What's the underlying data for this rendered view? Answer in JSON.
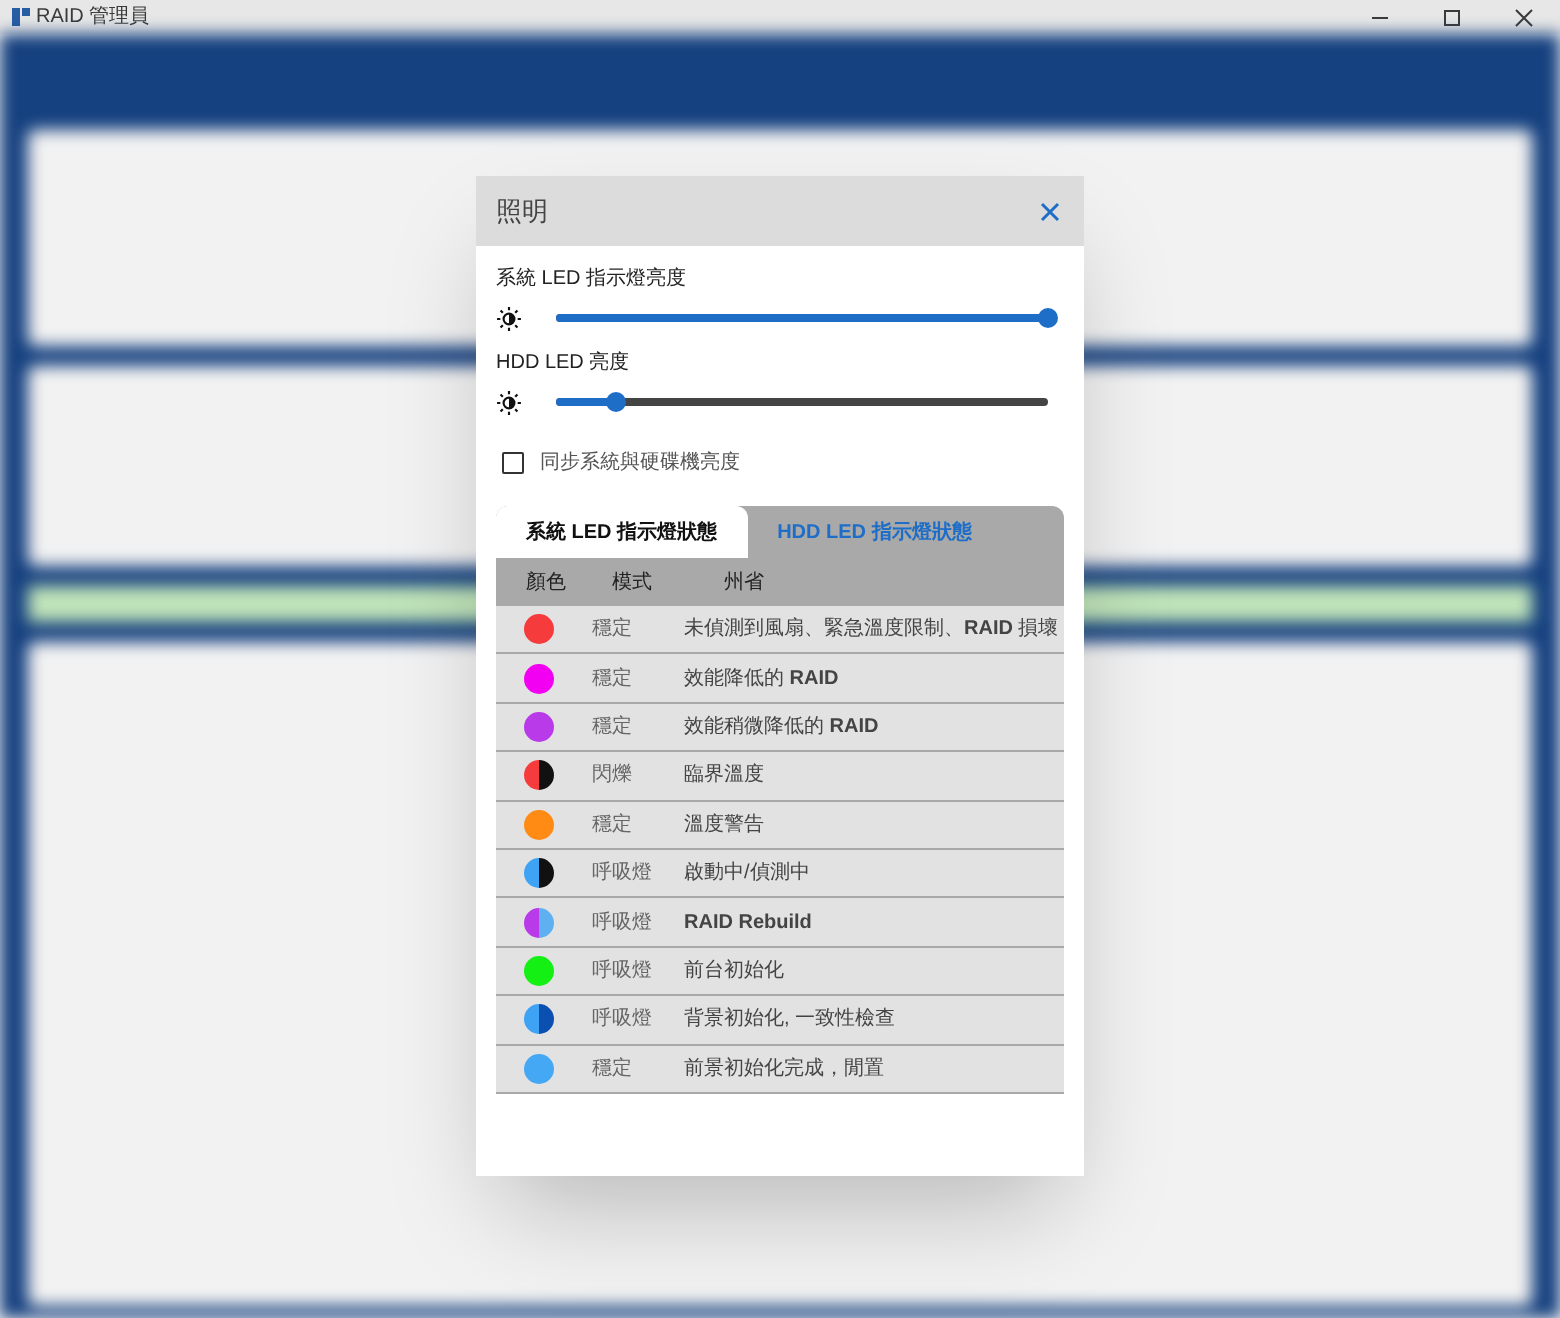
{
  "window": {
    "title": "RAID 管理員"
  },
  "dialog": {
    "title": "照明",
    "sliders": [
      {
        "label": "系統 LED 指示燈亮度",
        "level": 1.0
      },
      {
        "label": "HDD LED 亮度",
        "level": 0.12
      }
    ],
    "sync": {
      "label": "同步系統與硬碟機亮度",
      "checked": false
    },
    "tabs": [
      {
        "label": "系統 LED 指示燈狀態",
        "selected": true
      },
      {
        "label": "HDD LED 指示燈狀態",
        "selected": false
      }
    ],
    "table": {
      "columns": [
        "顏色",
        "模式",
        "州省"
      ],
      "rows": [
        {
          "kind": "solid",
          "color": "#f53b3b",
          "mode": "穩定",
          "description": "未偵測到風扇、緊急溫度限制、**RAID** 損壞"
        },
        {
          "kind": "solid",
          "color": "#f200f2",
          "mode": "穩定",
          "description": "效能降低的 **RAID**"
        },
        {
          "kind": "solid",
          "color": "#b83ae8",
          "mode": "穩定",
          "description": "效能稍微降低的 **RAID**"
        },
        {
          "kind": "split",
          "halves": [
            {
              "color": "#f53b3b"
            },
            {
              "color": "#111111"
            }
          ],
          "mode": "閃爍",
          "description": "臨界溫度"
        },
        {
          "kind": "solid",
          "color": "#ff8a14",
          "mode": "穩定",
          "description": "溫度警告"
        },
        {
          "kind": "split",
          "halves": [
            {
              "color": "#3ea2f5"
            },
            {
              "color": "#111111"
            }
          ],
          "mode": "呼吸燈",
          "description": "啟動中/偵測中"
        },
        {
          "kind": "split",
          "halves": [
            {
              "color": "#b83ae8"
            },
            {
              "color": "#5fb0f0"
            }
          ],
          "mode": "呼吸燈",
          "description": "**RAID Rebuild**"
        },
        {
          "kind": "solid",
          "color": "#14f014",
          "mode": "呼吸燈",
          "description": "前台初始化"
        },
        {
          "kind": "split",
          "halves": [
            {
              "color": "#3ea2f5"
            },
            {
              "color": "#0b4fb0"
            }
          ],
          "mode": "呼吸燈",
          "description": "背景初始化, 一致性檢查"
        },
        {
          "kind": "solid",
          "color": "#45a8f5",
          "mode": "穩定",
          "description": "前景初始化完成，閒置"
        }
      ]
    }
  }
}
